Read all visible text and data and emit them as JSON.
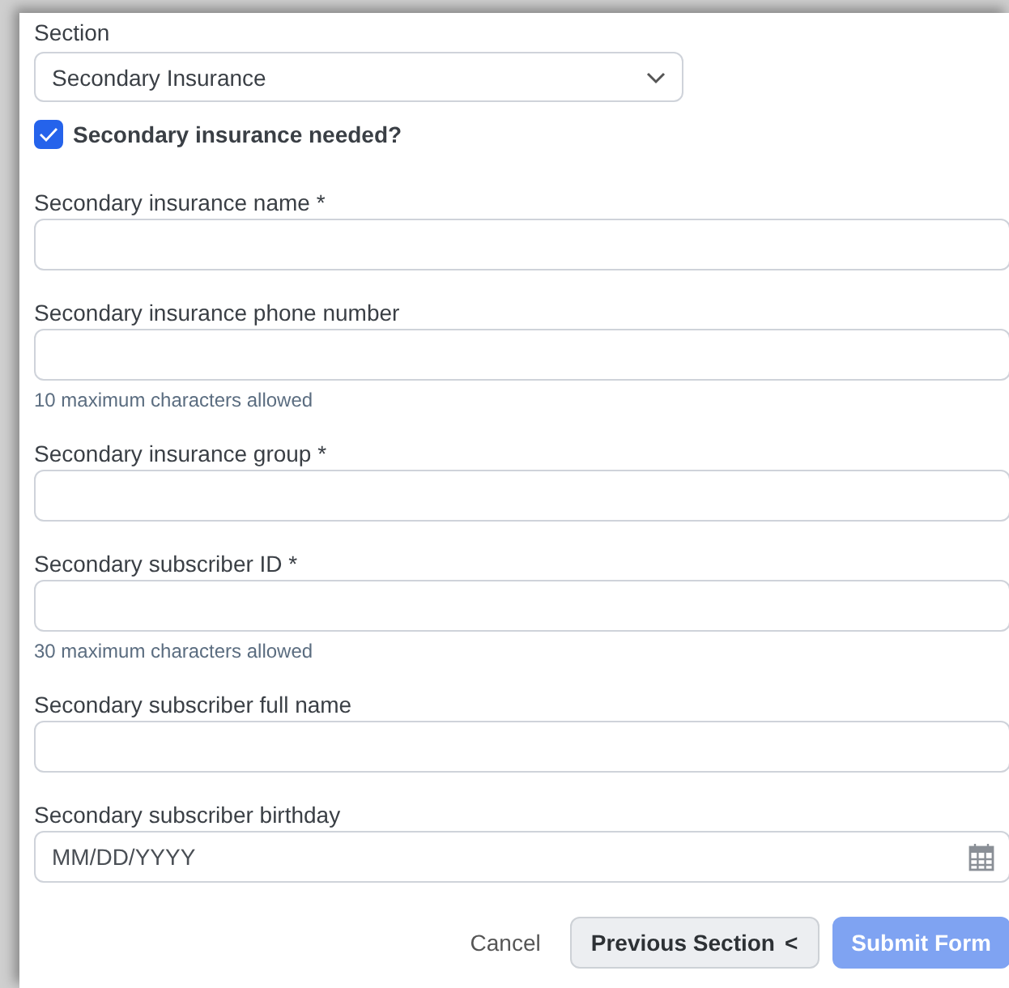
{
  "section": {
    "label": "Section",
    "value": "Secondary Insurance"
  },
  "needed": {
    "label": "Secondary insurance needed?",
    "checked": true
  },
  "fields": [
    {
      "kind": "text",
      "label": "Secondary insurance name *"
    },
    {
      "kind": "text",
      "label": "Secondary insurance phone number",
      "hint": "10 maximum characters allowed"
    },
    {
      "kind": "text",
      "label": "Secondary insurance group *"
    },
    {
      "kind": "text",
      "label": "Secondary subscriber ID *",
      "hint": "30 maximum characters allowed"
    },
    {
      "kind": "text",
      "label": "Secondary subscriber full name"
    },
    {
      "kind": "date",
      "label": "Secondary subscriber birthday",
      "placeholder": "MM/DD/YYYY"
    }
  ],
  "buttons": {
    "cancel": "Cancel",
    "previous": "Previous Section",
    "previous_icon": "<",
    "submit": "Submit Form",
    "submit_disabled": true
  }
}
